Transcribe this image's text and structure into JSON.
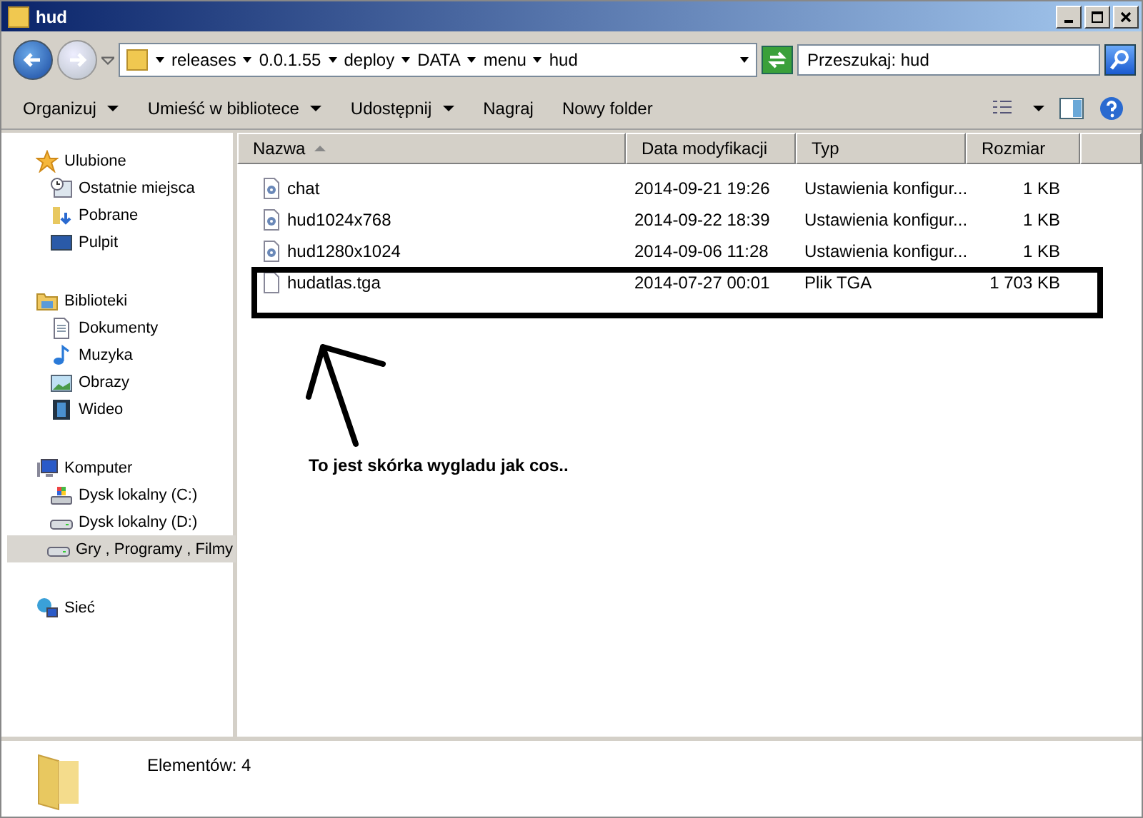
{
  "window": {
    "title": "hud"
  },
  "breadcrumbs": [
    "releases",
    "0.0.1.55",
    "deploy",
    "DATA",
    "menu",
    "hud"
  ],
  "search": {
    "placeholder": "Przeszukaj: hud"
  },
  "toolbar": [
    {
      "label": "Organizuj",
      "dropdown": true
    },
    {
      "label": "Umieść w bibliotece",
      "dropdown": true
    },
    {
      "label": "Udostępnij",
      "dropdown": true
    },
    {
      "label": "Nagraj",
      "dropdown": false
    },
    {
      "label": "Nowy folder",
      "dropdown": false
    }
  ],
  "sidebar": {
    "groups": [
      {
        "label": "Ulubione",
        "kind": "star",
        "items": [
          {
            "label": "Ostatnie miejsca",
            "kind": "recent",
            "selected": false
          },
          {
            "label": "Pobrane",
            "kind": "download",
            "selected": false
          },
          {
            "label": "Pulpit",
            "kind": "desktop",
            "selected": false
          }
        ]
      },
      {
        "label": "Biblioteki",
        "kind": "library",
        "items": [
          {
            "label": "Dokumenty",
            "kind": "document",
            "selected": false
          },
          {
            "label": "Muzyka",
            "kind": "music",
            "selected": false
          },
          {
            "label": "Obrazy",
            "kind": "image",
            "selected": false
          },
          {
            "label": "Wideo",
            "kind": "video",
            "selected": false
          }
        ]
      },
      {
        "label": "Komputer",
        "kind": "computer",
        "items": [
          {
            "label": "Dysk lokalny (C:)",
            "kind": "sysdrive",
            "selected": false
          },
          {
            "label": "Dysk lokalny (D:)",
            "kind": "drive",
            "selected": false
          },
          {
            "label": "Gry , Programy , Filmy",
            "kind": "drive",
            "selected": true
          }
        ]
      },
      {
        "label": "Sieć",
        "kind": "network"
      }
    ]
  },
  "table": {
    "columns": [
      {
        "label": "Nazwa",
        "sorted": true
      },
      {
        "label": "Data modyfikacji",
        "sorted": false
      },
      {
        "label": "Typ",
        "sorted": false
      },
      {
        "label": "Rozmiar",
        "sorted": false
      }
    ],
    "rows": [
      {
        "name": "chat",
        "kind": "config",
        "date": "2014-09-21 19:26",
        "type": "Ustawienia konfigur...",
        "size": "1 KB"
      },
      {
        "name": "hud1024x768",
        "kind": "config",
        "date": "2014-09-22 18:39",
        "type": "Ustawienia konfigur...",
        "size": "1 KB"
      },
      {
        "name": "hud1280x1024",
        "kind": "config",
        "date": "2014-09-06 11:28",
        "type": "Ustawienia konfigur...",
        "size": "1 KB"
      },
      {
        "name": "hudatlas.tga",
        "kind": "file",
        "date": "2014-07-27 00:01",
        "type": "Plik TGA",
        "size": "1 703 KB"
      }
    ]
  },
  "annotation": {
    "text": "To jest skórka wygladu jak cos.."
  },
  "status": {
    "text": "Elementów: 4"
  }
}
